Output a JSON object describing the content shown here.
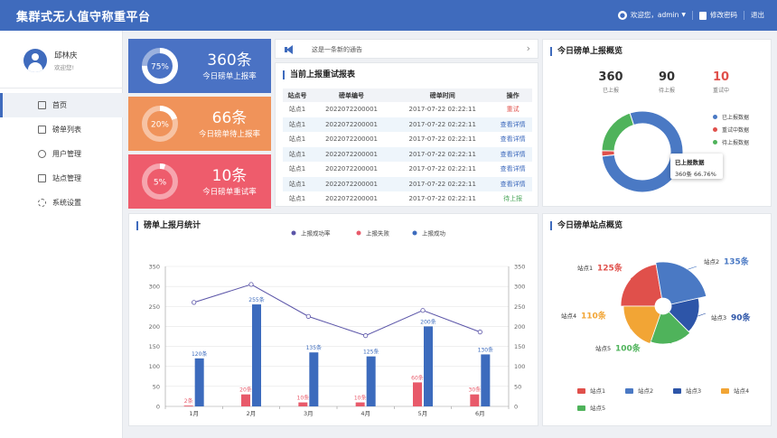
{
  "header": {
    "title": "集群式无人值守称重平台",
    "welcome": "欢迎您，admin",
    "change_password": "修改密码",
    "logout": "退出"
  },
  "profile": {
    "name": "邱林庆",
    "welcome": "欢迎您!"
  },
  "sidebar": {
    "items": [
      {
        "label": "首页",
        "icon": "dashboard-icon"
      },
      {
        "label": "磅单列表",
        "icon": "cube-icon"
      },
      {
        "label": "用户管理",
        "icon": "user-icon"
      },
      {
        "label": "站点管理",
        "icon": "station-icon"
      },
      {
        "label": "系统设置",
        "icon": "gear-icon"
      }
    ]
  },
  "stats": [
    {
      "value": "360条",
      "label": "今日磅单上报率",
      "percent": "75%",
      "fraction": 0.75,
      "color": "#4a72c4"
    },
    {
      "value": "66条",
      "label": "今日磅单待上报率",
      "percent": "20%",
      "fraction": 0.2,
      "color": "#f0935a"
    },
    {
      "value": "10条",
      "label": "今日磅单重试率",
      "percent": "5%",
      "fraction": 0.05,
      "color": "#ee5c6c"
    }
  ],
  "notice": {
    "text": "这是一条新的通告"
  },
  "report": {
    "title": "当前上报重试报表",
    "columns": [
      "站点号",
      "磅单编号",
      "磅单时间",
      "操作"
    ],
    "rows": [
      {
        "station": "站点1",
        "id": "2022072200001",
        "time": "2017-07-22  02:22:11",
        "action": "重试",
        "type": "red"
      },
      {
        "station": "站点1",
        "id": "2022072200001",
        "time": "2017-07-22  02:22:11",
        "action": "查看详情",
        "type": "blue"
      },
      {
        "station": "站点1",
        "id": "2022072200001",
        "time": "2017-07-22  02:22:11",
        "action": "查看详情",
        "type": "blue"
      },
      {
        "station": "站点1",
        "id": "2022072200001",
        "time": "2017-07-22  02:22:11",
        "action": "查看详情",
        "type": "blue"
      },
      {
        "station": "站点1",
        "id": "2022072200001",
        "time": "2017-07-22  02:22:11",
        "action": "查看详情",
        "type": "blue"
      },
      {
        "station": "站点1",
        "id": "2022072200001",
        "time": "2017-07-22  02:22:11",
        "action": "查看详情",
        "type": "blue"
      },
      {
        "station": "站点1",
        "id": "2022072200001",
        "time": "2017-07-22  02:22:11",
        "action": "待上报",
        "type": "green"
      }
    ]
  },
  "overview": {
    "title": "今日磅单上报概览",
    "values": [
      {
        "num": "360",
        "label": "已上报",
        "color": "#222222"
      },
      {
        "num": "90",
        "label": "待上报",
        "color": "#222222"
      },
      {
        "num": "10",
        "label": "重试中",
        "color": "#e0504b"
      }
    ],
    "tooltip": {
      "title": "已上报数据",
      "detail": "360条  66.76%"
    }
  },
  "chart_data": [
    {
      "type": "pie",
      "title": "今日磅单上报概览",
      "donut": true,
      "legend_position": "right",
      "labels": [
        "已上报数据",
        "重试中数据",
        "待上报数据"
      ],
      "values": [
        360,
        10,
        90
      ],
      "colors": [
        "#4a79c4",
        "#e0504b",
        "#4fb35b"
      ],
      "note": "ring arc visibly shows green majority and blue quarter"
    },
    {
      "type": "bar",
      "title": "磅单上报月统计",
      "categories": [
        "1月",
        "2月",
        "3月",
        "4月",
        "5月",
        "6月"
      ],
      "legend_position": "top",
      "series": [
        {
          "name": "上报成功率",
          "kind": "line",
          "values": [
            260,
            305,
            225,
            177,
            240,
            186
          ],
          "color": "#5b55a8"
        },
        {
          "name": "上报失败",
          "kind": "bar",
          "values": [
            2,
            30,
            10,
            10,
            60,
            30
          ],
          "labels": [
            "2条",
            "20条",
            "10条",
            "10条",
            "60条",
            "30条"
          ],
          "color": "#e85a6a"
        },
        {
          "name": "上报成功",
          "kind": "bar",
          "values": [
            120,
            255,
            135,
            125,
            200,
            130
          ],
          "labels": [
            "120条",
            "255条",
            "135条",
            "125条",
            "200条",
            "130条"
          ],
          "color": "#3c6bbd"
        }
      ],
      "ylim": [
        0,
        350
      ],
      "yticks": [
        0,
        50,
        100,
        150,
        200,
        250,
        300,
        350
      ],
      "grid": true
    },
    {
      "type": "pie",
      "title": "今日磅单站点概览",
      "rose": true,
      "legend_position": "bottom",
      "labels": [
        "站点1",
        "站点2",
        "站点3",
        "站点4",
        "站点5"
      ],
      "values": [
        125,
        135,
        90,
        110,
        100
      ],
      "value_labels": [
        "125条",
        "135条",
        "90条",
        "110条",
        "100条"
      ],
      "colors": [
        "#e0504b",
        "#4a79c4",
        "#2d55a8",
        "#f2a535",
        "#4fb35b"
      ]
    }
  ]
}
